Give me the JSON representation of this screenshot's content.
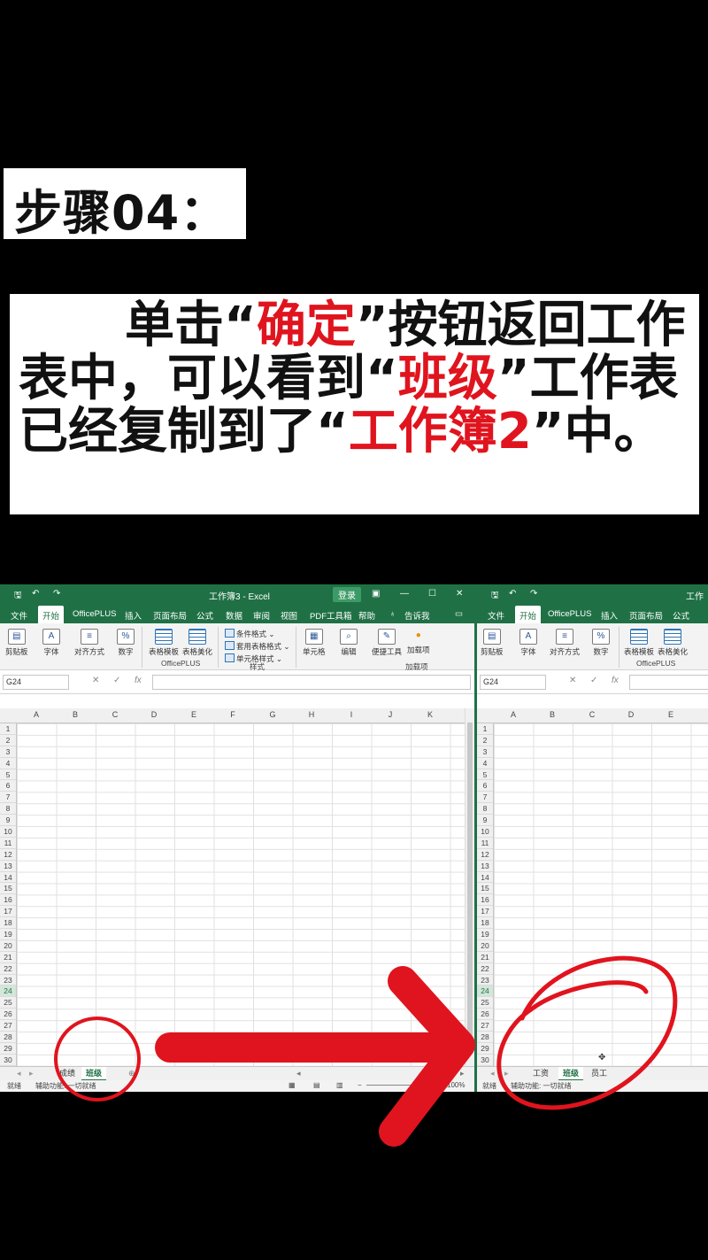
{
  "step": {
    "label": "步骤04："
  },
  "description": {
    "parts": [
      "单击“",
      "确定",
      "”按钮返回工作表中，可以看到“",
      "班级",
      "”工作表已经复制到了“",
      "工作簿2",
      "”中。"
    ]
  },
  "colors": {
    "excel_green": "#1f7145",
    "annotation_red": "#e0141e"
  },
  "left_window": {
    "title": "工作簿3 - Excel",
    "login_button": "登录",
    "menu": [
      "文件",
      "开始",
      "OfficePLUS",
      "插入",
      "页面布局",
      "公式",
      "数据",
      "审阅",
      "视图",
      "PDF工具箱",
      "帮助",
      "告诉我"
    ],
    "active_menu": "开始",
    "ribbon": {
      "clipboard": "剪贴板",
      "font": "字体",
      "align": "对齐方式",
      "number": "数字",
      "table_template": "表格模板",
      "table_beautify": "表格美化",
      "officeplus_group": "OfficePLUS",
      "cond_format": "条件格式",
      "table_style": "套用表格格式",
      "cell_style": "单元格样式",
      "style_group": "样式",
      "cells": "单元格",
      "edit": "编辑",
      "quick_tools": "便捷工具",
      "addins": "加载项",
      "addins_group": "加载项"
    },
    "name_box": "G24",
    "fx": "fx",
    "columns": [
      "A",
      "B",
      "C",
      "D",
      "E",
      "F",
      "G",
      "H",
      "I",
      "J",
      "K"
    ],
    "tabs": [
      "成绩",
      "班级"
    ],
    "active_tab": "班级",
    "status": {
      "ready": "就绪",
      "accessibility": "辅助功能: 一切就绪",
      "zoom": "100%"
    }
  },
  "right_window": {
    "title": "工作",
    "menu": [
      "文件",
      "开始",
      "OfficePLUS",
      "插入",
      "页面布局",
      "公式"
    ],
    "active_menu": "开始",
    "ribbon": {
      "clipboard": "剪贴板",
      "font": "字体",
      "align": "对齐方式",
      "number": "数字",
      "table_template": "表格模板",
      "table_beautify": "表格美化",
      "officeplus_group": "OfficePLUS"
    },
    "name_box": "G24",
    "fx": "fx",
    "columns": [
      "A",
      "B",
      "C",
      "D",
      "E"
    ],
    "tabs": [
      "工资",
      "班级",
      "员工"
    ],
    "active_tab": "班级",
    "status": {
      "ready": "就绪",
      "accessibility": "辅助功能: 一切就绪"
    }
  },
  "rows": [
    "1",
    "2",
    "3",
    "4",
    "5",
    "6",
    "7",
    "8",
    "9",
    "10",
    "11",
    "12",
    "13",
    "14",
    "15",
    "16",
    "17",
    "18",
    "19",
    "20",
    "21",
    "22",
    "23",
    "24",
    "25",
    "26",
    "27",
    "28",
    "29",
    "30"
  ],
  "selected_row": "24",
  "icons": [
    "save-icon",
    "undo-icon",
    "redo-icon",
    "minimize-icon",
    "maximize-icon",
    "close-icon",
    "search-icon",
    "comment-icon",
    "lightbulb-icon",
    "new-sheet-plus-icon",
    "cursor-icon",
    "arrow-annotation",
    "circle-annotation"
  ]
}
